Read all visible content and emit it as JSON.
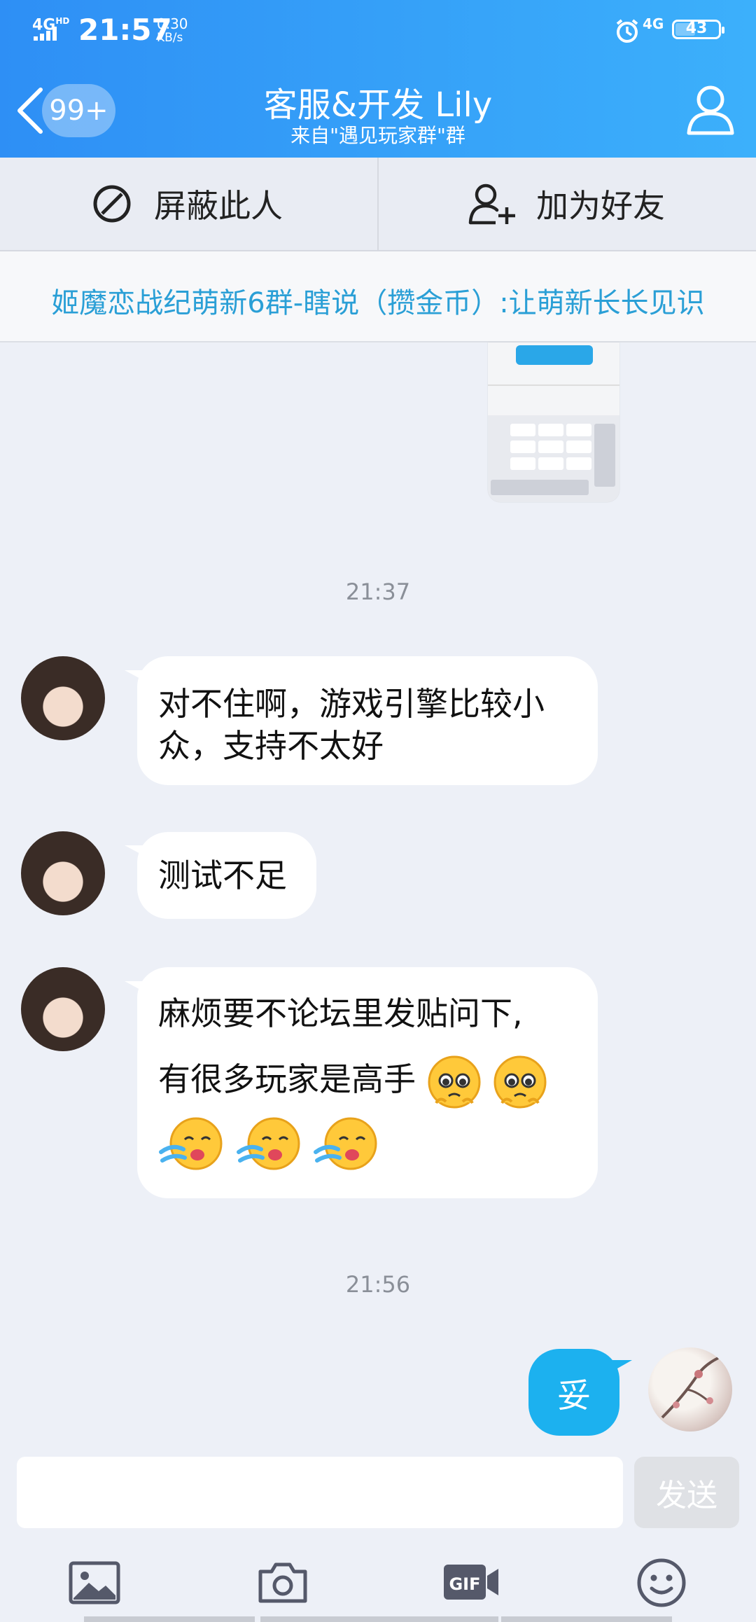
{
  "status_bar": {
    "network": "4G",
    "network_hd": "HD",
    "time": "21:57",
    "speed_value": "0.30",
    "speed_unit": "KB/s",
    "network_right": "4G",
    "battery": "43"
  },
  "header": {
    "back_badge": "99+",
    "title": "客服&开发  Lily",
    "subtitle": "来自\"遇见玩家群\"群"
  },
  "actions": {
    "block_label": "屏蔽此人",
    "add_friend_label": "加为好友"
  },
  "group_banner": "姬魔恋战纪萌新6群-瞎说（攒金币）:让萌新长长见识",
  "messages": [
    {
      "time": "21:37"
    },
    {
      "sender": "other",
      "text": "对不住啊，游戏引擎比较小众，支持不太好"
    },
    {
      "sender": "other",
      "text": "测试不足"
    },
    {
      "sender": "other",
      "text_line1": "麻烦要不论坛里发贴问下,",
      "text_line2": "有很多玩家是高手"
    },
    {
      "time": "21:56"
    },
    {
      "sender": "me",
      "text": "妥"
    }
  ],
  "composer": {
    "input_value": "",
    "send_label": "发送"
  },
  "toolbar_icons": [
    "image-icon",
    "camera-icon",
    "gif-icon",
    "emoji-icon"
  ],
  "colors": {
    "header_start": "#2e8ff5",
    "header_end": "#3cb0fb",
    "my_bubble": "#1cb1ef",
    "banner_text": "#2a9fd6",
    "background": "#edf0f7"
  }
}
